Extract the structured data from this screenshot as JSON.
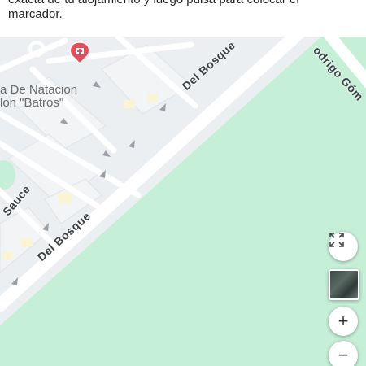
{
  "instructions": {
    "line1": "exacta de tu alojamiento y luego pulsa para colocar el",
    "line2": "marcador."
  },
  "map": {
    "poi_name_line1": "a De Natacion",
    "poi_name_line2": "lon \"Batros\"",
    "streets": {
      "del_bosque_upper": "Del Bosque",
      "del_bosque_lower": "Del Bosque",
      "rodrigo_gomez": "odrigo Góm",
      "sauce": "Sauce"
    },
    "park_color": "#c6efd8",
    "poi_marker_color": "#e84c5a"
  },
  "controls": {
    "fullscreen_icon": "fullscreen-icon",
    "layers_icon": "satellite-layer-thumbnail",
    "zoom_in": "+",
    "zoom_out": "−"
  }
}
